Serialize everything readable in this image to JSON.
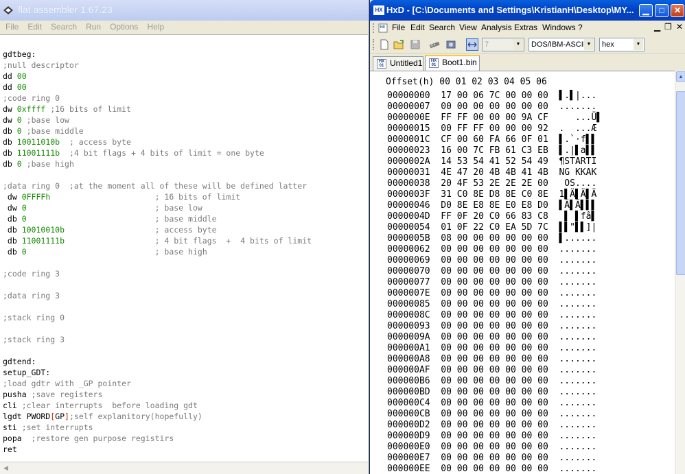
{
  "fasm": {
    "title": "flat assembler 1.67.23",
    "menu": [
      "File",
      "Edit",
      "Search",
      "Run",
      "Options",
      "Help"
    ],
    "code_lines": [
      [],
      [
        {
          "t": "gdtbeg:",
          "c": "kw"
        }
      ],
      [
        {
          "t": ";null descriptor",
          "c": "cm"
        }
      ],
      [
        {
          "t": "dd ",
          "c": "kw"
        },
        {
          "t": "00",
          "c": "num"
        }
      ],
      [
        {
          "t": "dd ",
          "c": "kw"
        },
        {
          "t": "00",
          "c": "num"
        }
      ],
      [
        {
          "t": ";code ring 0",
          "c": "cm"
        }
      ],
      [
        {
          "t": "dw ",
          "c": "kw"
        },
        {
          "t": "0xffff",
          "c": "num"
        },
        {
          "t": " ;16 bits of limit",
          "c": "cm"
        }
      ],
      [
        {
          "t": "dw ",
          "c": "kw"
        },
        {
          "t": "0",
          "c": "num"
        },
        {
          "t": " ;base low",
          "c": "cm"
        }
      ],
      [
        {
          "t": "db ",
          "c": "kw"
        },
        {
          "t": "0",
          "c": "num"
        },
        {
          "t": " ;base middle",
          "c": "cm"
        }
      ],
      [
        {
          "t": "db ",
          "c": "kw"
        },
        {
          "t": "10011010b",
          "c": "num"
        },
        {
          "t": "  ; access byte",
          "c": "cm"
        }
      ],
      [
        {
          "t": "db ",
          "c": "kw"
        },
        {
          "t": "11001111b",
          "c": "num"
        },
        {
          "t": "  ;4 bit flags + 4 bits of limit = one byte",
          "c": "cm"
        }
      ],
      [
        {
          "t": "db ",
          "c": "kw"
        },
        {
          "t": "0",
          "c": "num"
        },
        {
          "t": " ;base high",
          "c": "cm"
        }
      ],
      [],
      [
        {
          "t": ";data ring 0  ;at the moment all of these will be defined latter",
          "c": "cm"
        }
      ],
      [
        {
          "t": " dw ",
          "c": "kw"
        },
        {
          "t": "0FFFFh",
          "c": "num"
        },
        {
          "t": "                      ; 16 bits of limit",
          "c": "cm"
        }
      ],
      [
        {
          "t": " dw ",
          "c": "kw"
        },
        {
          "t": "0",
          "c": "num"
        },
        {
          "t": "                           ; base low",
          "c": "cm"
        }
      ],
      [
        {
          "t": " db ",
          "c": "kw"
        },
        {
          "t": "0",
          "c": "num"
        },
        {
          "t": "                           ; base middle",
          "c": "cm"
        }
      ],
      [
        {
          "t": " db ",
          "c": "kw"
        },
        {
          "t": "10010010b",
          "c": "num"
        },
        {
          "t": "                   ; access byte",
          "c": "cm"
        }
      ],
      [
        {
          "t": " db ",
          "c": "kw"
        },
        {
          "t": "11001111b",
          "c": "num"
        },
        {
          "t": "                   ; 4 bit flags  +  4 bits of limit",
          "c": "cm"
        }
      ],
      [
        {
          "t": " db ",
          "c": "kw"
        },
        {
          "t": "0",
          "c": "num"
        },
        {
          "t": "                           ; base high",
          "c": "cm"
        }
      ],
      [],
      [
        {
          "t": ";code ring 3",
          "c": "cm"
        }
      ],
      [],
      [
        {
          "t": ";data ring 3",
          "c": "cm"
        }
      ],
      [],
      [
        {
          "t": ";stack ring 0",
          "c": "cm"
        }
      ],
      [],
      [
        {
          "t": ";stack ring 3",
          "c": "cm"
        }
      ],
      [],
      [
        {
          "t": "gdtend:",
          "c": "kw"
        }
      ],
      [
        {
          "t": "setup_GDT:",
          "c": "kw"
        }
      ],
      [
        {
          "t": ";load gdtr with _GP pointer",
          "c": "cm"
        }
      ],
      [
        {
          "t": "pusha",
          "c": "kw"
        },
        {
          "t": " ;save registers",
          "c": "cm"
        }
      ],
      [
        {
          "t": "cli",
          "c": "kw"
        },
        {
          "t": " ;clear interrupts  before loading gdt",
          "c": "cm"
        }
      ],
      [
        {
          "t": "lgdt PWORD",
          "c": "kw"
        },
        {
          "t": "[",
          "c": "br"
        },
        {
          "t": "GP",
          "c": "kw"
        },
        {
          "t": "]",
          "c": "br"
        },
        {
          "t": ";self explanitory(hopefully)",
          "c": "cm"
        }
      ],
      [
        {
          "t": "sti",
          "c": "kw"
        },
        {
          "t": " ;set interrupts",
          "c": "cm"
        }
      ],
      [
        {
          "t": "popa",
          "c": "kw"
        },
        {
          "t": "  ;restore gen purpose registirs",
          "c": "cm"
        }
      ],
      [
        {
          "t": "ret",
          "c": "kw"
        }
      ]
    ]
  },
  "hxd": {
    "title": "HxD - [C:\\Documents and Settings\\KristianH\\Desktop\\MY...",
    "menu": [
      "File",
      "Edit",
      "Search",
      "View",
      "Analysis",
      "Extras",
      "Windows",
      "?"
    ],
    "toolbar": {
      "bytes_per_row": "7",
      "charset": "DOS/IBM-ASCII",
      "display": "hex"
    },
    "tabs": [
      "Untitled1",
      "Boot1.bin"
    ],
    "header": "Offset(h) 00 01 02 03 04 05 06",
    "rows": [
      [
        "00000000",
        "17 00 06 7C 00 00 00",
        "▌.▌|..."
      ],
      [
        "00000007",
        "00 00 00 00 00 00 00",
        "......."
      ],
      [
        "0000000E",
        "FF FF 00 00 00 9A CF",
        "   ...Ü▌"
      ],
      [
        "00000015",
        "00 FF FF 00 00 00 92",
        ".  ...Æ"
      ],
      [
        "0000001C",
        "CF 00 60 FA 66 0F 01",
        "▌.`·f▌▌"
      ],
      [
        "00000023",
        "16 00 7C FB 61 C3 EB",
        "▌.|▌a▌▌"
      ],
      [
        "0000002A",
        "14 53 54 41 52 54 49",
        "¶STARTI"
      ],
      [
        "00000031",
        "4E 47 20 4B 4B 41 4B",
        "NG KKAK"
      ],
      [
        "00000038",
        "20 4F 53 2E 2E 2E 00",
        " OS...."
      ],
      [
        "0000003F",
        "31 C0 8E D8 8E C0 8E",
        "1▌Ä▌Ä▌Ä"
      ],
      [
        "00000046",
        "D0 8E E8 8E E0 E8 D0",
        "▌Ä▌Ä▌▌▌"
      ],
      [
        "0000004D",
        "FF 0F 20 C0 66 83 C8",
        " ▌ ▌fâ▌"
      ],
      [
        "00000054",
        "01 0F 22 C0 EA 5D 7C",
        "▌▌\"▌▌]|"
      ],
      [
        "0000005B",
        "08 00 00 00 00 00 00",
        "▌......"
      ],
      [
        "00000062",
        "00 00 00 00 00 00 00",
        "......."
      ],
      [
        "00000069",
        "00 00 00 00 00 00 00",
        "......."
      ],
      [
        "00000070",
        "00 00 00 00 00 00 00",
        "......."
      ],
      [
        "00000077",
        "00 00 00 00 00 00 00",
        "......."
      ],
      [
        "0000007E",
        "00 00 00 00 00 00 00",
        "......."
      ],
      [
        "00000085",
        "00 00 00 00 00 00 00",
        "......."
      ],
      [
        "0000008C",
        "00 00 00 00 00 00 00",
        "......."
      ],
      [
        "00000093",
        "00 00 00 00 00 00 00",
        "......."
      ],
      [
        "0000009A",
        "00 00 00 00 00 00 00",
        "......."
      ],
      [
        "000000A1",
        "00 00 00 00 00 00 00",
        "......."
      ],
      [
        "000000A8",
        "00 00 00 00 00 00 00",
        "......."
      ],
      [
        "000000AF",
        "00 00 00 00 00 00 00",
        "......."
      ],
      [
        "000000B6",
        "00 00 00 00 00 00 00",
        "......."
      ],
      [
        "000000BD",
        "00 00 00 00 00 00 00",
        "......."
      ],
      [
        "000000C4",
        "00 00 00 00 00 00 00",
        "......."
      ],
      [
        "000000CB",
        "00 00 00 00 00 00 00",
        "......."
      ],
      [
        "000000D2",
        "00 00 00 00 00 00 00",
        "......."
      ],
      [
        "000000D9",
        "00 00 00 00 00 00 00",
        "......."
      ],
      [
        "000000E0",
        "00 00 00 00 00 00 00",
        "......."
      ],
      [
        "000000E7",
        "00 00 00 00 00 00 00",
        "......."
      ],
      [
        "000000EE",
        "00 00 00 00 00 00 00",
        "......."
      ]
    ]
  },
  "colors": {
    "fasm_comment": "#7a7a7a",
    "fasm_number": "#138a00",
    "xp_blue": "#0a3fb8"
  }
}
